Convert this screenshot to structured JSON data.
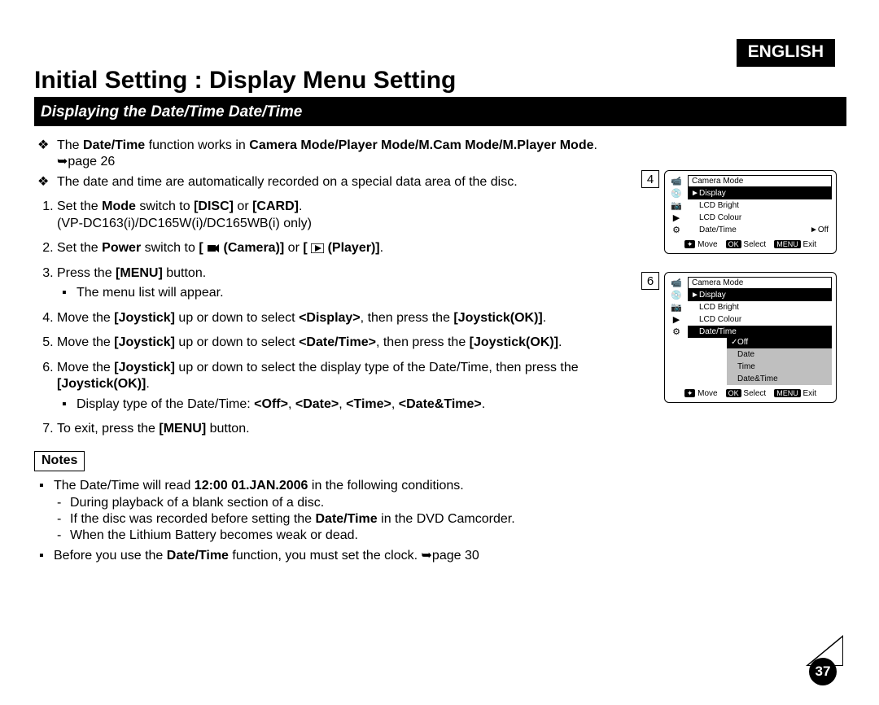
{
  "lang": "ENGLISH",
  "title": "Initial Setting : Display Menu Setting",
  "subtitle": "Displaying the Date/Time Date/Time",
  "intro": [
    "The <b>Date/Time</b> function works in <b>Camera Mode/Player Mode/M.Cam Mode/M.Player Mode</b>. ➥page 26",
    "The date and time are automatically recorded on a special data area of the disc."
  ],
  "steps": [
    {
      "html": "Set the <b>Mode</b> switch to <b>[DISC]</b> or <b>[CARD]</b>.<br>(VP-DC163(i)/DC165W(i)/DC165WB(i) only)"
    },
    {
      "html": "Set the <b>Power</b> switch to <b>[ <svg class='icon-inline' width='16' height='12'><rect x='1' y='2' width='10' height='8' fill='#000'/><polygon points='11,4 15,1 15,11 11,8' fill='#000'/></svg> (Camera)]</b> or <b>[ <svg class='icon-inline' width='16' height='12'><rect x='0' y='0' width='16' height='12' fill='none' stroke='#000' stroke-width='1.5'/><polygon points='5,2 13,6 5,10' fill='#000'/></svg> (Player)]</b>."
    },
    {
      "html": "Press the <b>[MENU]</b> button.",
      "sub": [
        "The menu list will appear."
      ]
    },
    {
      "html": "Move the <b>[Joystick]</b> up or down to select <b>&lt;Display&gt;</b>, then press the <b>[Joystick(OK)]</b>."
    },
    {
      "html": "Move the <b>[Joystick]</b> up or down to select <b>&lt;Date/Time&gt;</b>, then press the <b>[Joystick(OK)]</b>."
    },
    {
      "html": "Move the <b>[Joystick]</b> up or down to select the display type of the Date/Time, then press the <b>[Joystick(OK)]</b>.",
      "sub": [
        "Display type of the Date/Time: <b>&lt;Off&gt;</b>, <b>&lt;Date&gt;</b>, <b>&lt;Time&gt;</b>, <b>&lt;Date&amp;Time&gt;</b>."
      ]
    },
    {
      "html": "To exit, press the <b>[MENU]</b> button."
    }
  ],
  "notes_label": "Notes",
  "notes": [
    {
      "html": "The Date/Time will read <b>12:00 01.JAN.2006</b> in the following conditions.",
      "dash": [
        "During playback of a blank section of a disc.",
        "If the disc was recorded before setting the <b>Date/Time</b> in the DVD Camcorder.",
        "When the Lithium Battery becomes weak or dead."
      ]
    },
    {
      "html": "Before you use the <b>Date/Time</b> function, you must set the clock. ➥page 30"
    }
  ],
  "fig4": {
    "no": "4",
    "mode": "Camera Mode",
    "section": "Display",
    "items": [
      {
        "label": "LCD Bright"
      },
      {
        "label": "LCD Colour"
      },
      {
        "label": "Date/Time",
        "val": "Off",
        "arrow": true
      }
    ],
    "foot": {
      "move": "Move",
      "select": "Select",
      "exit": "Exit"
    }
  },
  "fig6": {
    "no": "6",
    "mode": "Camera Mode",
    "section": "Display",
    "items": [
      {
        "label": "LCD Bright"
      },
      {
        "label": "LCD Colour"
      },
      {
        "label": "Date/Time",
        "sel": true
      }
    ],
    "submenu": [
      {
        "label": "Off",
        "on": true
      },
      {
        "label": "Date"
      },
      {
        "label": "Time"
      },
      {
        "label": "Date&Time"
      }
    ],
    "foot": {
      "move": "Move",
      "select": "Select",
      "exit": "Exit"
    }
  },
  "pageno": "37"
}
